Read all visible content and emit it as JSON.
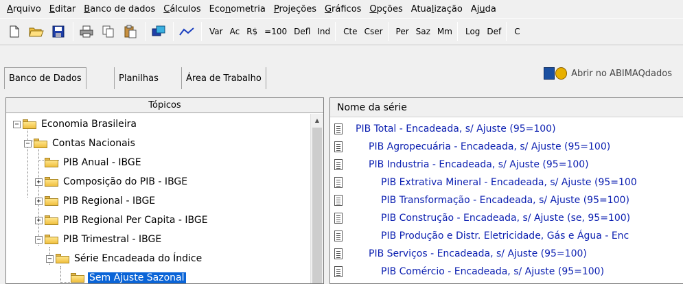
{
  "menu": [
    {
      "pre": "",
      "key": "A",
      "post": "rquivo"
    },
    {
      "pre": "",
      "key": "E",
      "post": "ditar"
    },
    {
      "pre": "",
      "key": "B",
      "post": "anco de dados"
    },
    {
      "pre": "",
      "key": "C",
      "post": "álculos"
    },
    {
      "pre": "Eco",
      "key": "n",
      "post": "ometria"
    },
    {
      "pre": "",
      "key": "P",
      "post": "rojeções"
    },
    {
      "pre": "",
      "key": "G",
      "post": "ráficos"
    },
    {
      "pre": "",
      "key": "O",
      "post": "pções"
    },
    {
      "pre": "Atua",
      "key": "l",
      "post": "ização"
    },
    {
      "pre": "Aj",
      "key": "u",
      "post": "da"
    }
  ],
  "toolbar": {
    "text_buttons": [
      "Var",
      "Ac",
      "R$",
      "=100",
      "Defl",
      "Ind",
      "Cte",
      "Cser",
      "Per",
      "Saz",
      "Mm",
      "Log",
      "Def",
      "C"
    ]
  },
  "tabs": [
    "Banco de Dados",
    "Planilhas",
    "Área de Trabalho"
  ],
  "abimaq_link": "Abrir no ABIMAQdados",
  "left_panel": {
    "header": "Tópicos",
    "tree": [
      {
        "label": "Economia Brasileira",
        "expander": "−"
      },
      {
        "label": "Contas Nacionais",
        "expander": "−"
      },
      {
        "label": "PIB Anual - IBGE",
        "expander": ""
      },
      {
        "label": "Composição do PIB - IBGE",
        "expander": "+"
      },
      {
        "label": "PIB Regional - IBGE",
        "expander": "+"
      },
      {
        "label": "PIB Regional Per Capita - IBGE",
        "expander": "+"
      },
      {
        "label": "PIB Trimestral - IBGE",
        "expander": "−"
      },
      {
        "label": "Série Encadeada do Índice",
        "expander": "−"
      },
      {
        "label": "Sem Ajuste Sazonal",
        "expander": ""
      }
    ]
  },
  "right_panel": {
    "header": "Nome da série",
    "series": [
      "PIB Total - Encadeada, s/ Ajuste (95=100)",
      "PIB Agropecuária - Encadeada, s/ Ajuste (95=100)",
      "PIB Industria - Encadeada, s/ Ajuste (95=100)",
      "PIB Extrativa Mineral - Encadeada, s/ Ajuste (95=100",
      "PIB Transformação - Encadeada, s/ Ajuste (95=100)",
      "PIB Construção - Encadeada, s/ Ajuste (se, 95=100)",
      "PIB Produção e Distr. Eletricidade, Gás e Água - Enc",
      "PIB Serviços - Encadeada, s/ Ajuste (95=100)",
      "PIB Comércio - Encadeada, s/ Ajuste (95=100)"
    ]
  },
  "colors": {
    "series_text": "#0a1eb0",
    "selection": "#0a64d7"
  }
}
